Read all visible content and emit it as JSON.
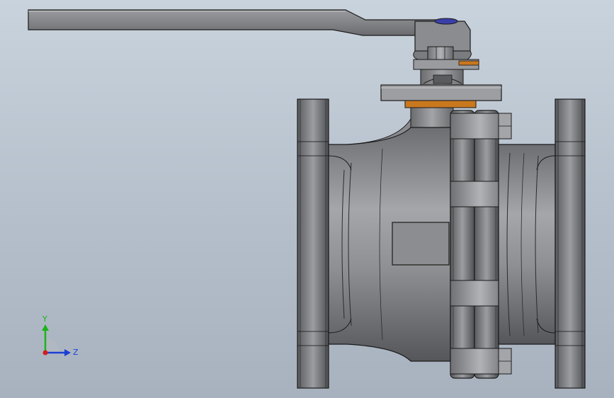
{
  "viewport": {
    "background_top": "#c9d3dd",
    "background_bottom": "#a8b2be"
  },
  "triad": {
    "y_label": "Y",
    "z_label": "Z",
    "y_color": "#1bb41b",
    "z_color": "#1c3fd4",
    "x_color": "#d41c1c"
  },
  "model": {
    "component": "ball-valve",
    "body_color": "#8e8f92",
    "edge_color": "#1a1a1a",
    "gasket_color": "#c9781e"
  }
}
